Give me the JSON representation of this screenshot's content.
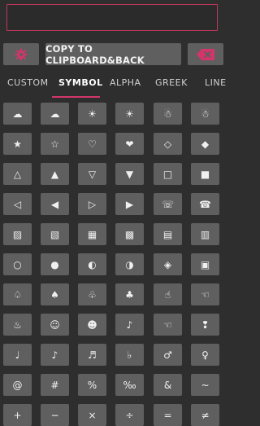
{
  "input": {
    "value": ""
  },
  "toolbar": {
    "copy_label": "COPY TO CLIPBOARD&BACK"
  },
  "tabs": [
    {
      "label": "CUSTOM"
    },
    {
      "label": "SYMBOL"
    },
    {
      "label": "ALPHA"
    },
    {
      "label": "GREEK"
    },
    {
      "label": "LINE"
    }
  ],
  "colors": {
    "accent": "#d2356a",
    "button_bg": "#5f5f5f",
    "background": "#2e2e2e"
  },
  "symbol_rows": [
    [
      "☁",
      "☁",
      "☀",
      "☀",
      "☃",
      "☃"
    ],
    [
      "★",
      "☆",
      "♡",
      "❤",
      "◇",
      "◆"
    ],
    [
      "△",
      "▲",
      "▽",
      "▼",
      "□",
      "■"
    ],
    [
      "◁",
      "◀",
      "▷",
      "▶",
      "☏",
      "☎"
    ],
    [
      "▨",
      "▧",
      "▦",
      "▩",
      "▤",
      "▥"
    ],
    [
      "○",
      "●",
      "◐",
      "◑",
      "◈",
      "▣"
    ],
    [
      "♤",
      "♠",
      "♧",
      "♣",
      "☝",
      "☜"
    ],
    [
      "♨",
      "☺",
      "☻",
      "♪",
      "☜",
      "❢"
    ],
    [
      "♩",
      "♪",
      "♬",
      "♭",
      "♂",
      "♀"
    ],
    [
      "@",
      "#",
      "%",
      "‰",
      "&",
      "~"
    ],
    [
      "+",
      "−",
      "×",
      "÷",
      "=",
      "≠"
    ]
  ]
}
